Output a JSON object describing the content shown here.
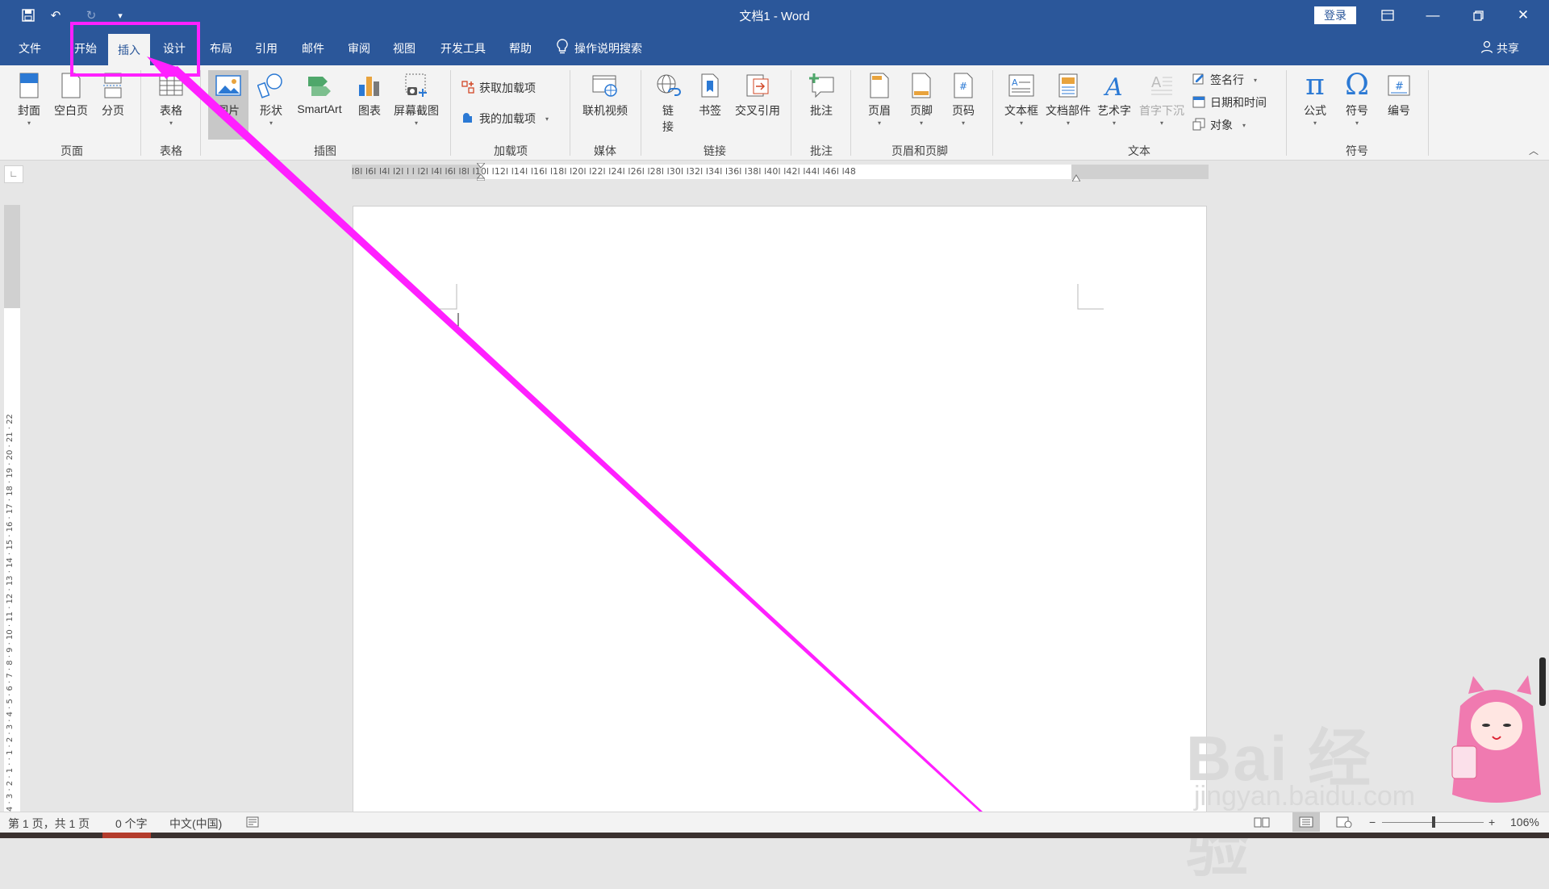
{
  "window": {
    "title": "文档1  -  Word",
    "login_label": "登录",
    "controls": [
      "ribbon-display-icon",
      "minimize-icon",
      "restore-icon",
      "close-icon"
    ]
  },
  "qat": {
    "save": "save-icon",
    "undo": "undo-icon",
    "redo": "redo-icon",
    "customize": "customize-icon"
  },
  "tabs": [
    {
      "label": "文件"
    },
    {
      "label": "开始"
    },
    {
      "label": "插入"
    },
    {
      "label": "设计"
    },
    {
      "label": "布局"
    },
    {
      "label": "引用"
    },
    {
      "label": "邮件"
    },
    {
      "label": "审阅"
    },
    {
      "label": "视图"
    },
    {
      "label": "开发工具"
    },
    {
      "label": "帮助"
    }
  ],
  "active_tab": "插入",
  "tell_me": "操作说明搜索",
  "share": "共享",
  "ribbon": {
    "pages": {
      "cover": "封面",
      "blank": "空白页",
      "break": "分页",
      "group": "页面"
    },
    "tables": {
      "table": "表格",
      "group": "表格"
    },
    "illustrations": {
      "pictures": "图片",
      "shapes": "形状",
      "smartart": "SmartArt",
      "chart": "图表",
      "screenshot": "屏幕截图",
      "group": "插图"
    },
    "addins": {
      "get": "获取加载项",
      "my": "我的加载项",
      "group": "加载项"
    },
    "media": {
      "online_video": "联机视频",
      "group": "媒体"
    },
    "links": {
      "link1": "链",
      "link2": "接",
      "bookmark": "书签",
      "crossref": "交叉引用",
      "group": "链接"
    },
    "comments": {
      "comment": "批注",
      "group": "批注"
    },
    "header_footer": {
      "header": "页眉",
      "footer": "页脚",
      "page_number": "页码",
      "group": "页眉和页脚"
    },
    "text": {
      "textbox": "文本框",
      "quick_parts": "文档部件",
      "wordart": "艺术字",
      "dropcap": "首字下沉",
      "signature": "签名行",
      "datetime": "日期和时间",
      "object": "对象",
      "group": "文本"
    },
    "symbols": {
      "equation": "公式",
      "symbol": "符号",
      "numbering": "编号",
      "group": "符号"
    }
  },
  "ruler": {
    "h_labels": "l8l  l6l  l4l  l2l  l    l  l2l  l4l  l6l  l8l  l10l  l12l  l14l  l16l  l18l  l20l  l22l  l24l  l26l  l28l  l30l  l32l  l34l  l36l  l38l  l40l  l42l  l44l  l46l  l48",
    "v_labels": "4 · 3 · 2 · 1 · · 1 · 2 · 3 · 4 · 5 · 6 · 7 · 8 · 9 · 10 · 11 · 12 · 13 · 14 · 15 · 16 · 17 · 18 · 19 · 20 · 21 · 22"
  },
  "status": {
    "page": "第 1 页，共 1 页",
    "words": "0 个字",
    "language": "中文(中国)",
    "zoom": "106%"
  },
  "watermark": {
    "text": "Bai 经验",
    "url": "jingyan.baidu.com"
  },
  "annotation": {
    "color": "#ff20ff"
  }
}
